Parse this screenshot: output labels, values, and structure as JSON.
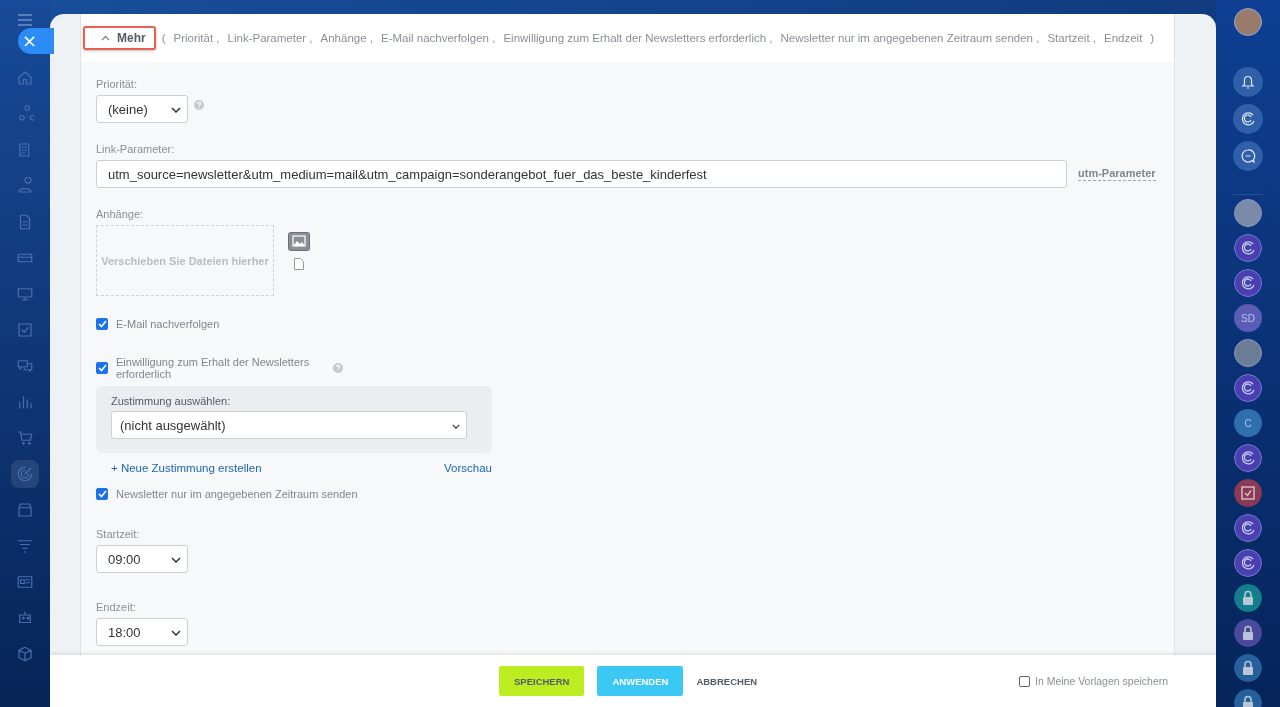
{
  "close_button": {
    "label": "×"
  },
  "left_nav": {
    "items": [
      {
        "kind": "home",
        "selected": false
      },
      {
        "kind": "flow",
        "selected": false
      },
      {
        "kind": "news",
        "selected": false
      },
      {
        "kind": "people",
        "selected": false
      },
      {
        "kind": "doc",
        "selected": false
      },
      {
        "kind": "card",
        "selected": false
      },
      {
        "kind": "board",
        "selected": false
      },
      {
        "kind": "check",
        "selected": false
      },
      {
        "kind": "chat",
        "selected": false
      },
      {
        "kind": "chart",
        "selected": false
      },
      {
        "kind": "cart",
        "selected": false
      },
      {
        "kind": "target",
        "selected": true
      },
      {
        "kind": "store",
        "selected": false
      },
      {
        "kind": "funnel",
        "selected": false
      },
      {
        "kind": "idcard",
        "selected": false
      },
      {
        "kind": "robot",
        "selected": false
      },
      {
        "kind": "box",
        "selected": false
      }
    ]
  },
  "header": {
    "toggle": {
      "label": "Mehr",
      "expanded": true
    },
    "open_paren": "(",
    "close_paren": ")",
    "fields": [
      "Priorität ,",
      "Link-Parameter ,",
      "Anhänge ,",
      "E-Mail nachverfolgen ,",
      "Einwilligung zum Erhalt der Newsletters erforderlich ,",
      "Newsletter nur im angegebenen Zeitraum senden ,",
      "Startzeit ,",
      "Endzeit"
    ]
  },
  "priority": {
    "label": "Priorität:",
    "value": "(keine)"
  },
  "link_parameter": {
    "label": "Link-Parameter:",
    "value": "utm_source=newsletter&utm_medium=mail&utm_campaign=sonderangebot_fuer_das_beste_kinderfest",
    "link": "utm-Parameter"
  },
  "attachments": {
    "label": "Anhänge:",
    "dropzone": "Verschieben Sie Dateien hierher"
  },
  "track_email": {
    "label": "E-Mail nachverfolgen",
    "checked": true
  },
  "consent": {
    "label": "Einwilligung zum Erhalt der Newsletters erforderlich",
    "checked": true,
    "select_label": "Zustimmung auswählen:",
    "select_value": "(nicht ausgewählt)",
    "create_link": "+ Neue Zustimmung erstellen",
    "preview_link": "Vorschau"
  },
  "time_window": {
    "label": "Newsletter nur im angegebenen Zeitraum senden",
    "checked": true
  },
  "start_time": {
    "label": "Startzeit:",
    "value": "09:00"
  },
  "end_time": {
    "label": "Endzeit:",
    "value": "18:00"
  },
  "footer": {
    "buttons": [
      {
        "label": "SPEICHERN",
        "kind": "save"
      },
      {
        "label": "ANWENDEN",
        "kind": "apply"
      },
      {
        "label": "ABBRECHEN",
        "kind": "cancel"
      }
    ],
    "template": {
      "label": "In Meine Vorlagen speichern",
      "checked": false
    }
  },
  "right_bar": {
    "top": [
      {
        "kind": "avatar"
      },
      {
        "kind": "bell"
      },
      {
        "kind": "openline"
      },
      {
        "kind": "search-chat"
      }
    ],
    "items": [
      {
        "kind": "avatar",
        "color": "#7a8aa8"
      },
      {
        "kind": "openline",
        "color": "#4a3fb0"
      },
      {
        "kind": "openline",
        "color": "#4a3fb0"
      },
      {
        "kind": "initials",
        "text": "SD",
        "color": "#5a5cb5"
      },
      {
        "kind": "avatar",
        "color": "#6b7d95"
      },
      {
        "kind": "openline",
        "color": "#4a3fb0"
      },
      {
        "kind": "initials",
        "text": "C",
        "color": "#2f6fae"
      },
      {
        "kind": "openline",
        "color": "#4a3fb0"
      },
      {
        "kind": "task",
        "color": "#8a3a55"
      },
      {
        "kind": "openline",
        "color": "#4a3fb0"
      },
      {
        "kind": "openline",
        "color": "#4a3fb0"
      },
      {
        "kind": "lock",
        "color": "#137e8c"
      },
      {
        "kind": "lock",
        "color": "#4a4a9c"
      },
      {
        "kind": "lock",
        "color": "#255f9c"
      },
      {
        "kind": "lock",
        "color": "#255f9c"
      }
    ]
  }
}
